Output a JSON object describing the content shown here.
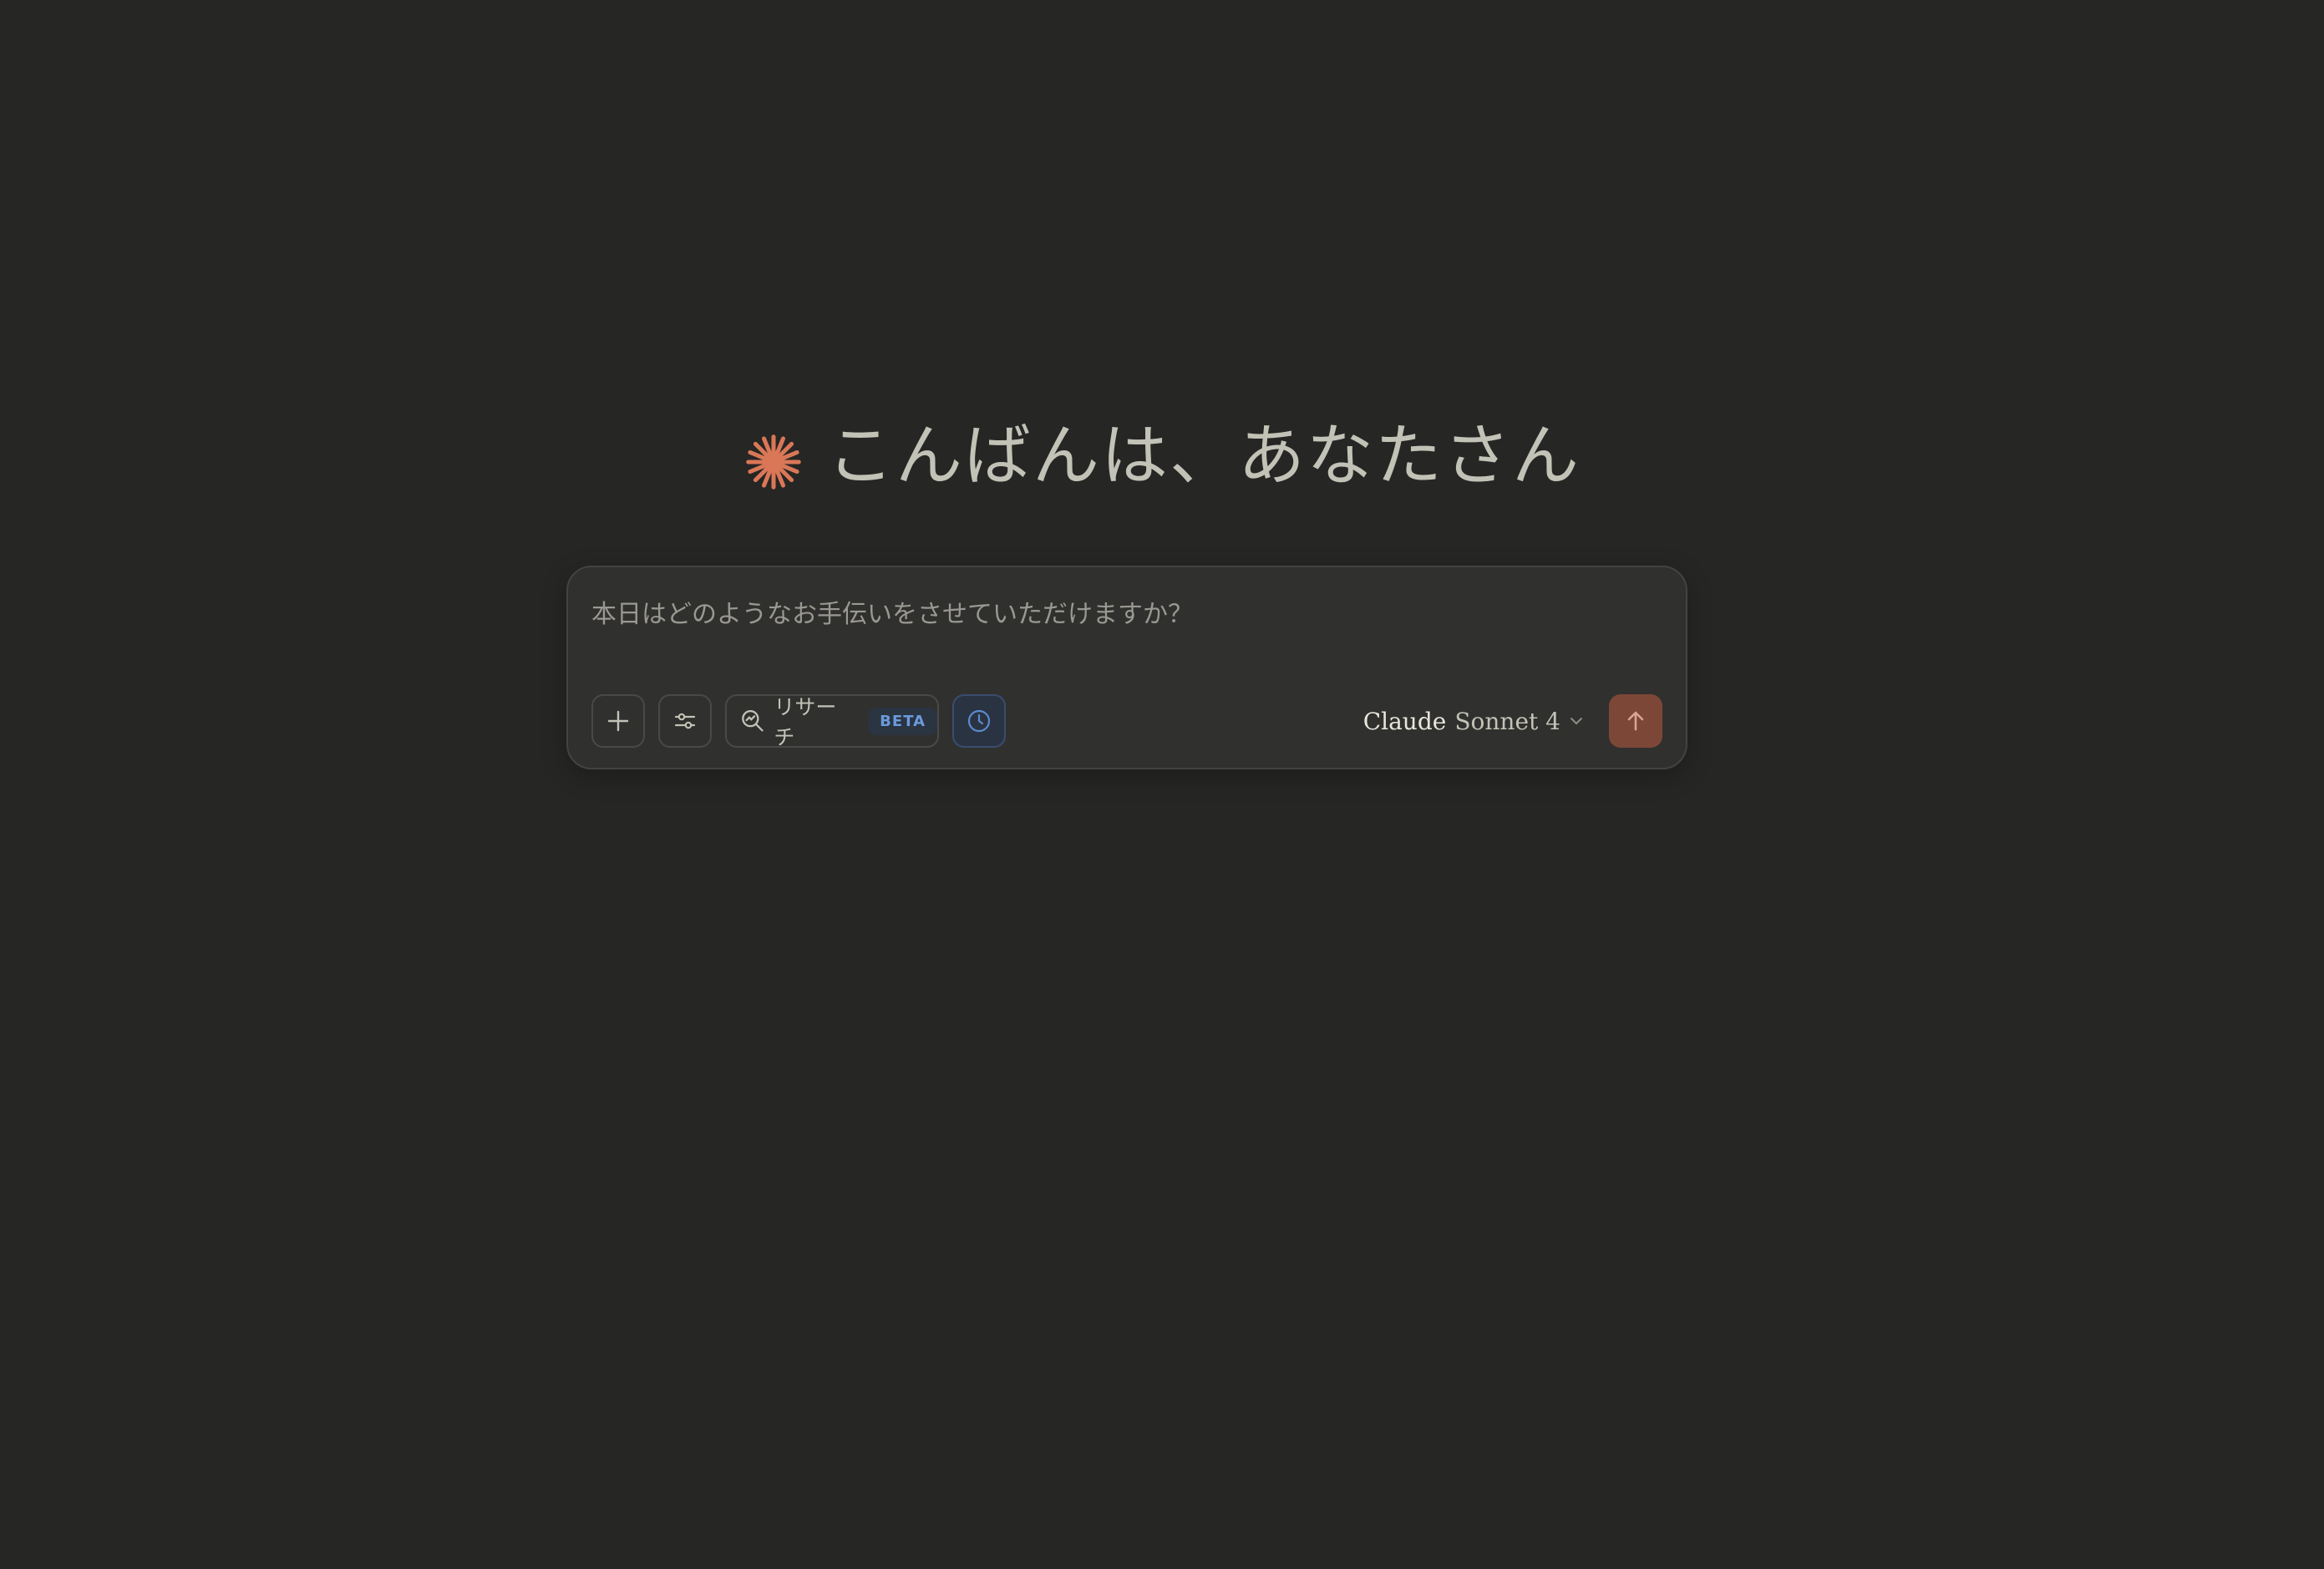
{
  "greeting": {
    "text": "こんばんは、あなたさん",
    "icon": "claude-spark-icon",
    "icon_color": "#d97757"
  },
  "composer": {
    "placeholder": "本日はどのようなお手伝いをさせていただけますか？",
    "value": "",
    "add_icon": "plus-icon",
    "tools_icon": "sliders-icon",
    "research": {
      "icon": "research-search-icon",
      "label": "リサーチ",
      "badge": "BETA",
      "badge_color": "#6a9bdc"
    },
    "extended_thinking_icon": "clock-icon",
    "model": {
      "brand": "Claude",
      "name": "Sonnet 4",
      "chevron_icon": "chevron-down-icon"
    },
    "send": {
      "icon": "arrow-up-icon",
      "color": "#7c4737"
    }
  },
  "colors": {
    "background": "#262624",
    "composer_background": "#30302e",
    "accent": "#d97757"
  }
}
